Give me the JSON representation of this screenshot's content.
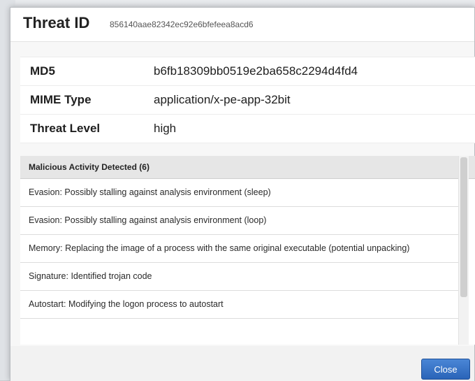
{
  "dialog": {
    "title": "Threat ID",
    "threat_id": "856140aae82342ec92e6bfefeea8acd6"
  },
  "info": [
    {
      "key": "MD5",
      "value": "b6fb18309bb0519e2ba658c2294d4fd4"
    },
    {
      "key": "MIME Type",
      "value": "application/x-pe-app-32bit"
    },
    {
      "key": "Threat Level",
      "value": "high"
    }
  ],
  "activity": {
    "header": "Malicious Activity Detected (6)",
    "items": [
      "Evasion: Possibly stalling against analysis environment (sleep)",
      "Evasion: Possibly stalling against analysis environment (loop)",
      "Memory: Replacing the image of a process with the same original executable (potential unpacking)",
      "Signature: Identified trojan code",
      "Autostart: Modifying the logon process to autostart"
    ]
  },
  "footer": {
    "close_label": "Close"
  },
  "colors": {
    "accent": "#2f6bc0",
    "header_bg": "#e6e6e6"
  }
}
